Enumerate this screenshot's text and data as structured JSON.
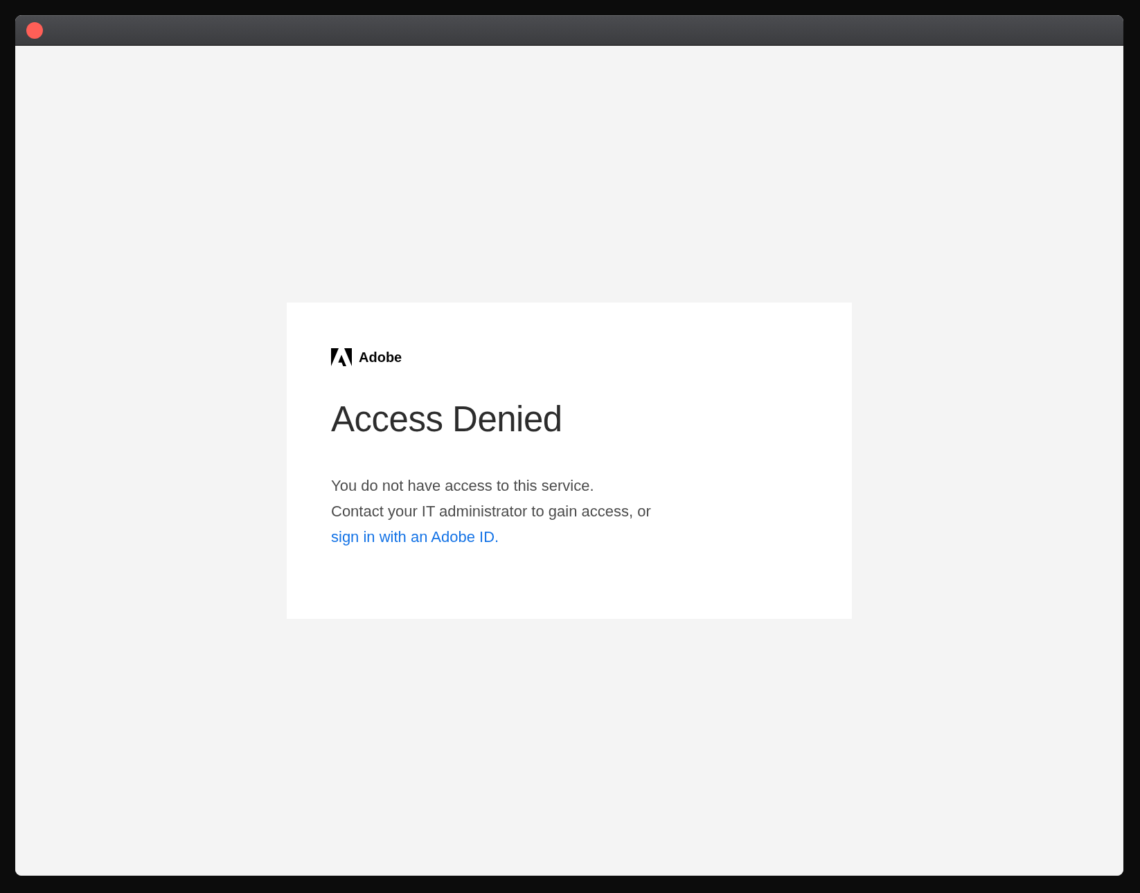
{
  "card": {
    "brand": "Adobe",
    "heading": "Access Denied",
    "message": "You do not have access to this service.",
    "instruction": "Contact your IT administrator to gain access, or",
    "link": "sign in with an Adobe ID."
  }
}
